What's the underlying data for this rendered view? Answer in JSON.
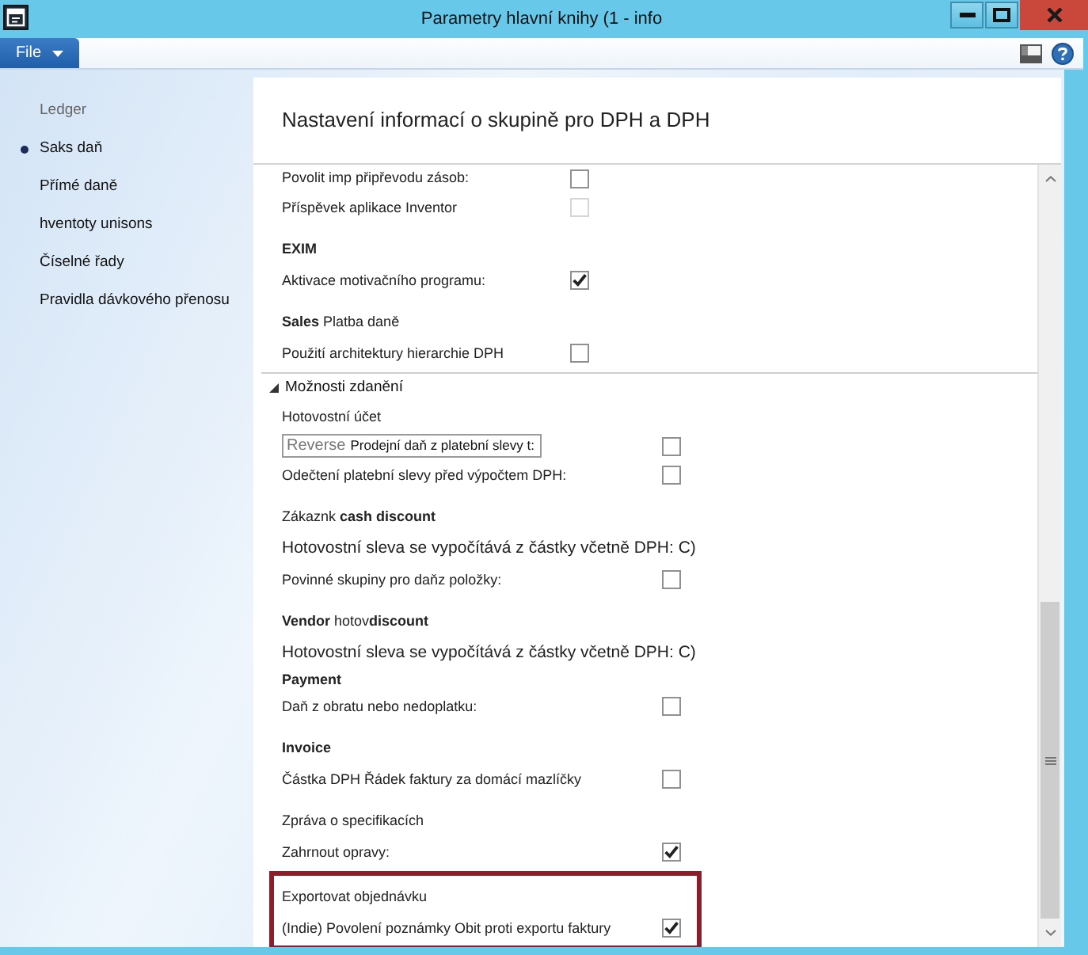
{
  "window": {
    "title": "Parametry hlavní knihy (1 - info"
  },
  "menu": {
    "file": "File"
  },
  "sidebar": {
    "heading": "Ledger",
    "items": [
      {
        "label": "Saks daň",
        "selected": true
      },
      {
        "label": "Přímé daně",
        "selected": false
      },
      {
        "label": "hventoty unisons",
        "selected": false
      },
      {
        "label": "Číselné řady",
        "selected": false
      },
      {
        "label": "Pravidla dávkového přenosu",
        "selected": false
      }
    ]
  },
  "panel": {
    "title": "Nastavení informací o skupině pro DPH a DPH",
    "sections": [
      {
        "highlighted": false,
        "rows": [
          {
            "kind": "checkbox",
            "label": "Povolit imp připřevodu zásob:",
            "checked": false,
            "disabled": false
          },
          {
            "kind": "checkbox",
            "label": "Příspěvek aplikace Inventor",
            "checked": false,
            "disabled": true
          },
          {
            "kind": "heading",
            "label": "EXIM"
          },
          {
            "kind": "checkbox",
            "label": "Aktivace motivačního programu:",
            "checked": true,
            "disabled": false
          },
          {
            "kind": "label",
            "label": "**Sales** Platba daně"
          },
          {
            "kind": "checkbox",
            "label": "Použití architektury hierarchie DPH",
            "checked": false,
            "disabled": false
          }
        ]
      },
      {
        "title": "Možnosti zdanění",
        "expanded": true,
        "highlighted": false,
        "rows": [
          {
            "kind": "label",
            "label": "Hotovostní účet"
          },
          {
            "kind": "field",
            "prefix": "Reverse",
            "value": "Prodejní daň z platební slevy t:",
            "checked": false,
            "disabled": false
          },
          {
            "kind": "checkbox",
            "label": "Odečtení platební slevy před výpočtem DPH:",
            "checked": false,
            "disabled": false
          },
          {
            "kind": "label",
            "label": "Zákaznk  **cash discount**"
          },
          {
            "kind": "note",
            "label": "Hotovostní sleva se vypočítává z částky včetně DPH: C)"
          },
          {
            "kind": "checkbox",
            "label": "Povinné skupiny pro daňz položky:",
            "checked": false,
            "disabled": false
          },
          {
            "kind": "label",
            "label": "**Vendor** hotov**discount**"
          },
          {
            "kind": "note",
            "label": "Hotovostní sleva se vypočítává z částky včetně DPH: C)"
          },
          {
            "kind": "heading",
            "label": "Payment"
          },
          {
            "kind": "checkbox",
            "label": "Daň z obratu nebo nedoplatku:",
            "checked": false,
            "disabled": false
          },
          {
            "kind": "heading",
            "label": "Invoice"
          },
          {
            "kind": "checkbox",
            "label": "Částka DPH Řádek faktury za domácí mazlíčky",
            "checked": false,
            "disabled": false
          },
          {
            "kind": "label",
            "label": "Zpráva o specifikacích"
          },
          {
            "kind": "checkbox",
            "label": "Zahrnout opravy:",
            "checked": true,
            "disabled": false
          }
        ]
      },
      {
        "highlighted": true,
        "rows": [
          {
            "kind": "label",
            "label": "Exportovat objednávku"
          },
          {
            "kind": "checkbox",
            "label": "(Indie) Povolení poznámky Obit proti exportu faktury",
            "checked": true,
            "disabled": false
          }
        ]
      }
    ]
  }
}
